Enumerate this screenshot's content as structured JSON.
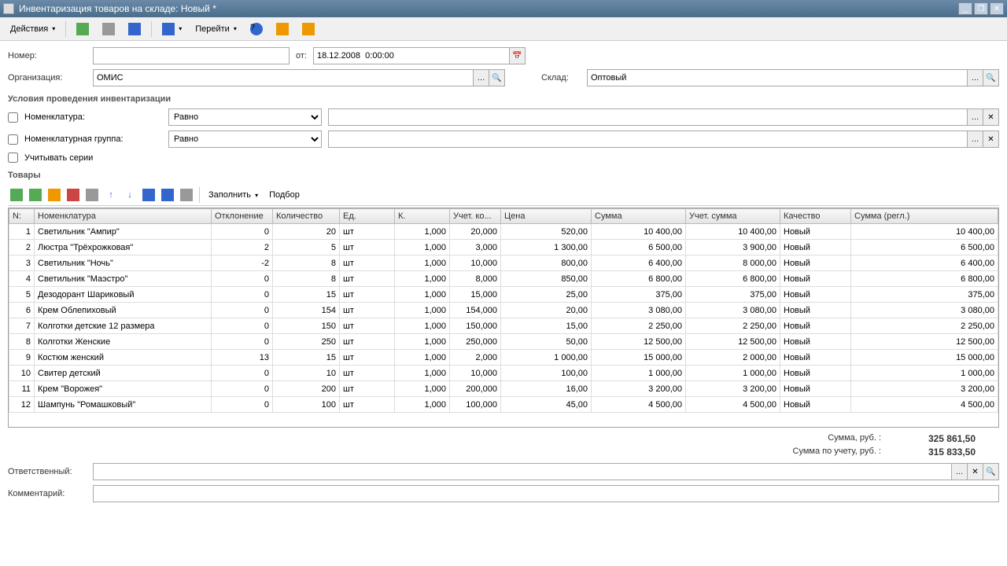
{
  "window": {
    "title": "Инвентаризация товаров на складе: Новый *"
  },
  "toolbar": {
    "actions": "Действия",
    "go": "Перейти"
  },
  "form": {
    "number_label": "Номер:",
    "number_value": "",
    "date_label": "от:",
    "date_value": "18.12.2008  0:00:00",
    "org_label": "Организация:",
    "org_value": "ОМИС",
    "warehouse_label": "Склад:",
    "warehouse_value": "Оптовый",
    "conditions_title": "Условия проведения инвентаризации",
    "nomenclature_label": "Номенклатура:",
    "nomenclature_group_label": "Номенклатурная группа:",
    "op_equal": "Равно",
    "series_label": "Учитывать серии",
    "goods_title": "Товары",
    "fill": "Заполнить",
    "selection": "Подбор",
    "responsible_label": "Ответственный:",
    "responsible_value": "",
    "comment_label": "Комментарий:",
    "comment_value": ""
  },
  "columns": {
    "n": "N:",
    "name": "Номенклатура",
    "dev": "Отклонение",
    "qty": "Количество",
    "unit": "Ед.",
    "k": "К.",
    "acc_qty": "Учет. ко...",
    "price": "Цена",
    "sum": "Сумма",
    "acc_sum": "Учет. сумма",
    "quality": "Качество",
    "reg_sum": "Сумма (регл.)"
  },
  "rows": [
    {
      "n": "1",
      "name": "Светильник \"Ампир\"",
      "dev": "0",
      "qty": "20",
      "unit": "шт",
      "k": "1,000",
      "acc_qty": "20,000",
      "price": "520,00",
      "sum": "10 400,00",
      "acc_sum": "10 400,00",
      "quality": "Новый",
      "reg_sum": "10 400,00"
    },
    {
      "n": "2",
      "name": "Люстра \"Трёхрожковая\"",
      "dev": "2",
      "qty": "5",
      "unit": "шт",
      "k": "1,000",
      "acc_qty": "3,000",
      "price": "1 300,00",
      "sum": "6 500,00",
      "acc_sum": "3 900,00",
      "quality": "Новый",
      "reg_sum": "6 500,00"
    },
    {
      "n": "3",
      "name": "Светильник \"Ночь\"",
      "dev": "-2",
      "qty": "8",
      "unit": "шт",
      "k": "1,000",
      "acc_qty": "10,000",
      "price": "800,00",
      "sum": "6 400,00",
      "acc_sum": "8 000,00",
      "quality": "Новый",
      "reg_sum": "6 400,00"
    },
    {
      "n": "4",
      "name": "Светильник \"Маэстро\"",
      "dev": "0",
      "qty": "8",
      "unit": "шт",
      "k": "1,000",
      "acc_qty": "8,000",
      "price": "850,00",
      "sum": "6 800,00",
      "acc_sum": "6 800,00",
      "quality": "Новый",
      "reg_sum": "6 800,00"
    },
    {
      "n": "5",
      "name": "Дезодорант Шариковый",
      "dev": "0",
      "qty": "15",
      "unit": "шт",
      "k": "1,000",
      "acc_qty": "15,000",
      "price": "25,00",
      "sum": "375,00",
      "acc_sum": "375,00",
      "quality": "Новый",
      "reg_sum": "375,00"
    },
    {
      "n": "6",
      "name": "Крем Облепиховый",
      "dev": "0",
      "qty": "154",
      "unit": "шт",
      "k": "1,000",
      "acc_qty": "154,000",
      "price": "20,00",
      "sum": "3 080,00",
      "acc_sum": "3 080,00",
      "quality": "Новый",
      "reg_sum": "3 080,00"
    },
    {
      "n": "7",
      "name": "Колготки детские 12 размера",
      "dev": "0",
      "qty": "150",
      "unit": "шт",
      "k": "1,000",
      "acc_qty": "150,000",
      "price": "15,00",
      "sum": "2 250,00",
      "acc_sum": "2 250,00",
      "quality": "Новый",
      "reg_sum": "2 250,00"
    },
    {
      "n": "8",
      "name": "Колготки Женские",
      "dev": "0",
      "qty": "250",
      "unit": "шт",
      "k": "1,000",
      "acc_qty": "250,000",
      "price": "50,00",
      "sum": "12 500,00",
      "acc_sum": "12 500,00",
      "quality": "Новый",
      "reg_sum": "12 500,00"
    },
    {
      "n": "9",
      "name": "Костюм женский",
      "dev": "13",
      "qty": "15",
      "unit": "шт",
      "k": "1,000",
      "acc_qty": "2,000",
      "price": "1 000,00",
      "sum": "15 000,00",
      "acc_sum": "2 000,00",
      "quality": "Новый",
      "reg_sum": "15 000,00"
    },
    {
      "n": "10",
      "name": "Свитер детский",
      "dev": "0",
      "qty": "10",
      "unit": "шт",
      "k": "1,000",
      "acc_qty": "10,000",
      "price": "100,00",
      "sum": "1 000,00",
      "acc_sum": "1 000,00",
      "quality": "Новый",
      "reg_sum": "1 000,00"
    },
    {
      "n": "11",
      "name": "Крем \"Ворожея\"",
      "dev": "0",
      "qty": "200",
      "unit": "шт",
      "k": "1,000",
      "acc_qty": "200,000",
      "price": "16,00",
      "sum": "3 200,00",
      "acc_sum": "3 200,00",
      "quality": "Новый",
      "reg_sum": "3 200,00"
    },
    {
      "n": "12",
      "name": "Шампунь \"Ромашковый\"",
      "dev": "0",
      "qty": "100",
      "unit": "шт",
      "k": "1,000",
      "acc_qty": "100,000",
      "price": "45,00",
      "sum": "4 500,00",
      "acc_sum": "4 500,00",
      "quality": "Новый",
      "reg_sum": "4 500,00"
    }
  ],
  "totals": {
    "sum_label": "Сумма, руб. :",
    "sum_value": "325 861,50",
    "acc_sum_label": "Сумма по учету, руб. :",
    "acc_sum_value": "315 833,50"
  }
}
